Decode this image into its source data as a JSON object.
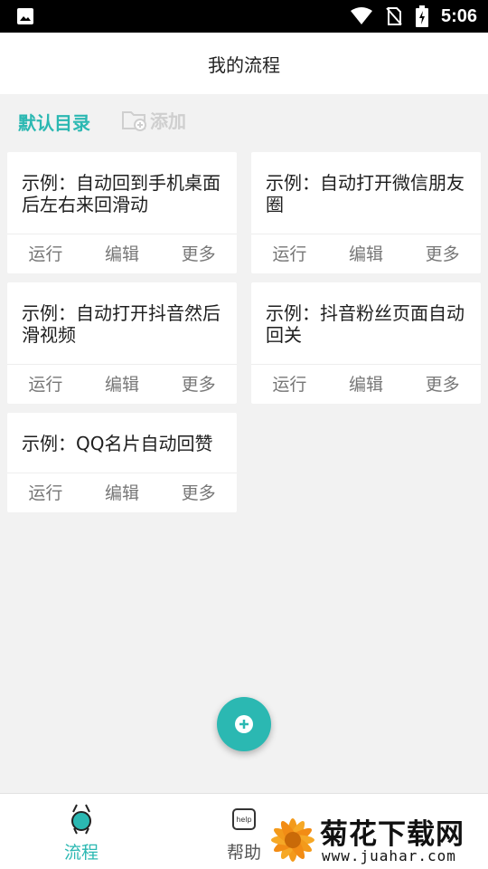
{
  "status_bar": {
    "time": "5:06",
    "icons": [
      "image-icon",
      "wifi-icon",
      "no-sim-icon",
      "battery-charging-icon"
    ]
  },
  "header": {
    "title": "我的流程"
  },
  "toolbar": {
    "tab_label": "默认目录",
    "add_label": "添加"
  },
  "cards": [
    {
      "title": "示例：自动回到手机桌面后左右来回滑动",
      "actions": {
        "run": "运行",
        "edit": "编辑",
        "more": "更多"
      }
    },
    {
      "title": "示例：自动打开微信朋友圈",
      "actions": {
        "run": "运行",
        "edit": "编辑",
        "more": "更多"
      }
    },
    {
      "title": "示例：自动打开抖音然后滑视频",
      "actions": {
        "run": "运行",
        "edit": "编辑",
        "more": "更多"
      }
    },
    {
      "title": "示例：抖音粉丝页面自动回关",
      "actions": {
        "run": "运行",
        "edit": "编辑",
        "more": "更多"
      }
    },
    {
      "title": "示例：QQ名片自动回赞",
      "actions": {
        "run": "运行",
        "edit": "编辑",
        "more": "更多"
      }
    }
  ],
  "fab": {
    "icon": "plus-icon"
  },
  "bottom_nav": {
    "items": [
      {
        "label": "流程",
        "icon": "flow-icon",
        "active": true
      },
      {
        "label": "帮助",
        "icon": "help-icon",
        "icon_text": "help",
        "active": false
      }
    ]
  },
  "watermark": {
    "title": "菊花下载网",
    "url": "www.juahar.com"
  },
  "colors": {
    "accent": "#2bb8b2",
    "muted": "#cfcfcf",
    "background": "#f2f2f2"
  }
}
